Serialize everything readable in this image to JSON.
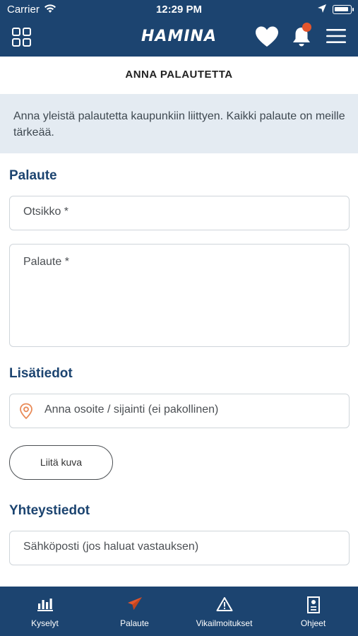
{
  "status_bar": {
    "carrier": "Carrier",
    "time": "12:29 PM"
  },
  "app": {
    "logo_text": "HAMINA",
    "accent_color": "#1c4470",
    "notification_dot_color": "#e4562d",
    "icons": [
      "grid-icon",
      "heart-icon",
      "bell-icon",
      "menu-icon"
    ]
  },
  "page": {
    "title": "ANNA PALAUTETTA",
    "intro": "Anna yleistä palautetta kaupunkiin liittyen. Kaikki palaute on meille tärkeää."
  },
  "form": {
    "section_feedback": "Palaute",
    "title_placeholder": "Otsikko *",
    "feedback_placeholder": "Palaute *",
    "section_details": "Lisätiedot",
    "location_placeholder": "Anna osoite / sijainti (ei pakollinen)",
    "attach_button": "Liitä kuva",
    "section_contact": "Yhteystiedot",
    "email_placeholder": "Sähköposti (jos haluat vastauksen)"
  },
  "tabs": [
    {
      "label": "Kyselyt",
      "icon": "bar-chart-icon",
      "active": false
    },
    {
      "label": "Palaute",
      "icon": "paper-plane-icon",
      "active": true
    },
    {
      "label": "Vikailmoitukset",
      "icon": "warning-icon",
      "active": false
    },
    {
      "label": "Ohjeet",
      "icon": "document-icon",
      "active": false
    }
  ]
}
